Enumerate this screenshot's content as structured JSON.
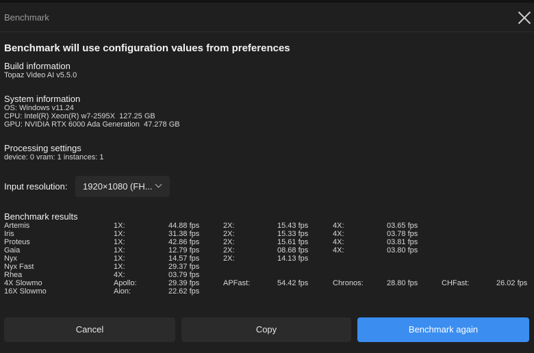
{
  "window": {
    "title": "Benchmark"
  },
  "heading": "Benchmark will use configuration values from preferences",
  "build": {
    "title": "Build information",
    "version": "Topaz Video AI v5.5.0"
  },
  "system": {
    "title": "System information",
    "os": "OS: Windows v11.24",
    "cpu": "CPU: Intel(R) Xeon(R) w7-2595X  127.25 GB",
    "gpu": "GPU: NVIDIA RTX 6000 Ada Generation  47.278 GB"
  },
  "processing": {
    "title": "Processing settings",
    "values": "device: 0 vram: 1 instances: 1"
  },
  "input_resolution": {
    "label": "Input resolution:",
    "selected": "1920×1080 (FH..."
  },
  "results": {
    "title": "Benchmark results",
    "rows": [
      {
        "model": "Artemis",
        "cells": [
          [
            "1X:",
            "44.88 fps"
          ],
          [
            "2X:",
            "15.43 fps"
          ],
          [
            "4X:",
            "03.65 fps"
          ]
        ]
      },
      {
        "model": "Iris",
        "cells": [
          [
            "1X:",
            "31.38 fps"
          ],
          [
            "2X:",
            "15.33 fps"
          ],
          [
            "4X:",
            "03.78 fps"
          ]
        ]
      },
      {
        "model": "Proteus",
        "cells": [
          [
            "1X:",
            "42.86 fps"
          ],
          [
            "2X:",
            "15.61 fps"
          ],
          [
            "4X:",
            "03.81 fps"
          ]
        ]
      },
      {
        "model": "Gaia",
        "cells": [
          [
            "1X:",
            "12.79 fps"
          ],
          [
            "2X:",
            "08.68 fps"
          ],
          [
            "4X:",
            "03.80 fps"
          ]
        ]
      },
      {
        "model": "Nyx",
        "cells": [
          [
            "1X:",
            "14.57 fps"
          ],
          [
            "2X:",
            "14.13 fps"
          ]
        ]
      },
      {
        "model": "Nyx Fast",
        "cells": [
          [
            "1X:",
            "29.37 fps"
          ]
        ]
      },
      {
        "model": "Rhea",
        "cells": [
          [
            "4X:",
            "03.79 fps"
          ]
        ]
      },
      {
        "model": "4X Slowmo",
        "cells": [
          [
            "Apollo:",
            "29.39 fps"
          ],
          [
            "APFast:",
            "54.42 fps"
          ],
          [
            "Chronos:",
            "28.80 fps"
          ],
          [
            "CHFast:",
            "26.02 fps"
          ]
        ]
      },
      {
        "model": "16X Slowmo",
        "cells": [
          [
            "Aion:",
            "22.62 fps"
          ]
        ]
      }
    ]
  },
  "buttons": {
    "cancel": "Cancel",
    "copy": "Copy",
    "again": "Benchmark again"
  },
  "colors": {
    "background": "#1f1f1f",
    "primary": "#3b8ef0",
    "secondary_button": "#2b2b2b"
  }
}
